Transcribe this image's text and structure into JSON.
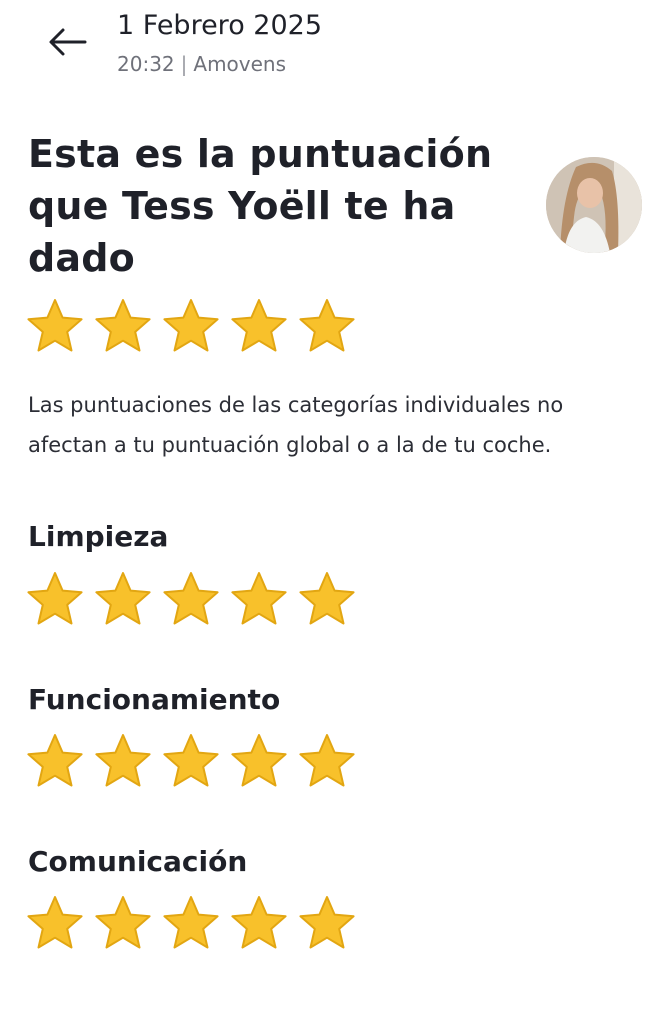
{
  "header": {
    "date": "1 Febrero 2025",
    "time": "20:32",
    "separator": "|",
    "company": "Amovens",
    "back_icon": "arrow-left-icon"
  },
  "main": {
    "title": "Esta es la puntuación que Tess Yoëll te ha dado",
    "avatar_icon": "avatar",
    "overall_rating": 5,
    "max_rating": 5,
    "notice": "Las puntuaciones de las categorías individuales no afectan a tu puntuación global o a la de tu coche."
  },
  "categories": [
    {
      "label": "Limpieza",
      "rating": 5
    },
    {
      "label": "Funcionamiento",
      "rating": 5
    },
    {
      "label": "Comunicación",
      "rating": 5
    }
  ],
  "colors": {
    "star_fill": "#f8c12b",
    "star_edge": "#e2a612",
    "text_primary": "#1f2129",
    "text_secondary": "#6f717a"
  }
}
